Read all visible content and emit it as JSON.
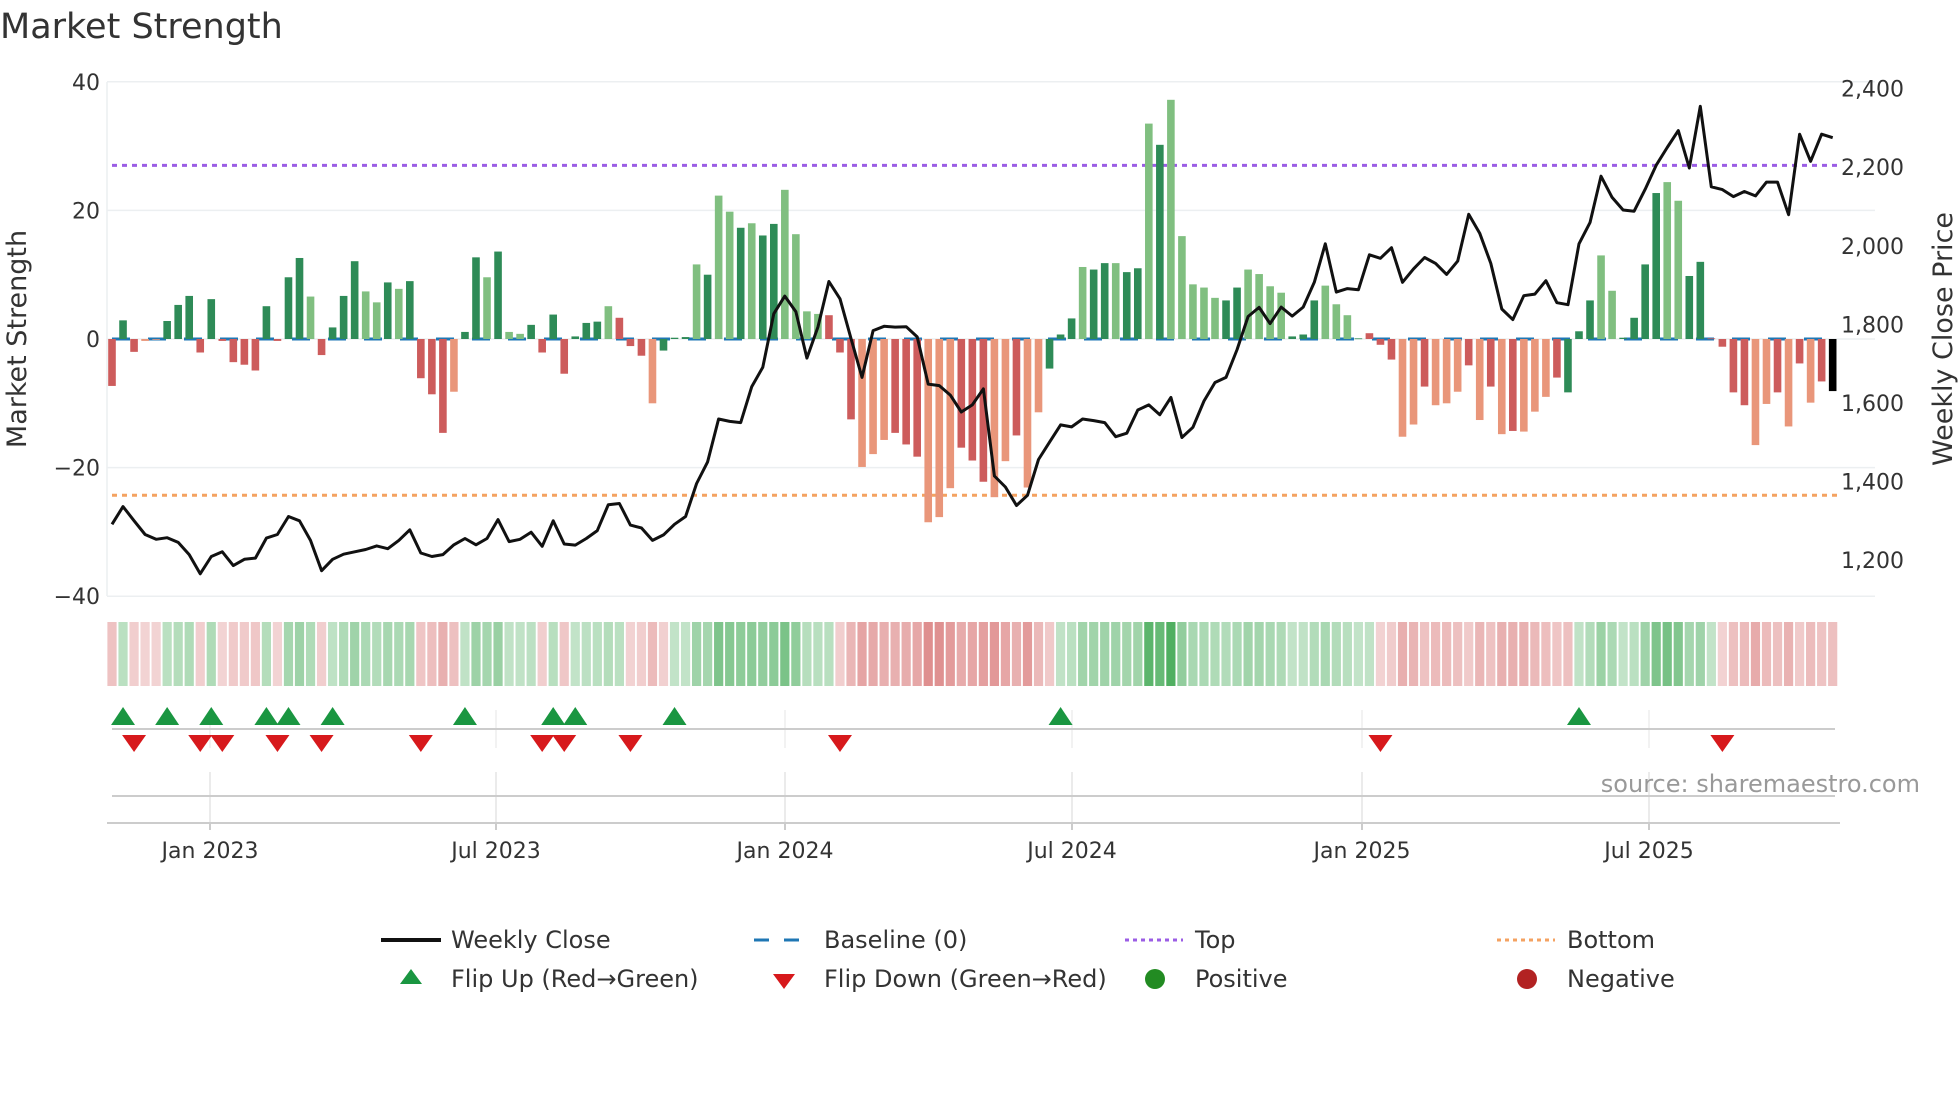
{
  "chart_data": {
    "type": "bar+line",
    "title": "Market Strength",
    "ylabel_left": "Market Strength",
    "ylabel_right": "Weekly Close Price",
    "ylim_left": [
      -40,
      40
    ],
    "ylim_right": [
      1100,
      2400
    ],
    "yticks_left": [
      "40",
      "20",
      "0",
      "−20",
      "−40"
    ],
    "yticks_left_values": [
      40,
      20,
      0,
      -20,
      -40
    ],
    "yticks_right": [
      "2,400",
      "2,200",
      "2,000",
      "1,800",
      "1,600",
      "1,400",
      "1,200"
    ],
    "yticks_right_values": [
      2400,
      2200,
      2000,
      1800,
      1600,
      1400,
      1200
    ],
    "xticks": [
      "Jan 2023",
      "Jul 2023",
      "Jan 2024",
      "Jul 2024",
      "Jan 2025",
      "Jul 2025"
    ],
    "top_threshold": 27,
    "bottom_threshold": -24.3,
    "baseline": 0,
    "strength": [
      -7.3,
      2.9,
      -2,
      -0.3,
      -0.1,
      2.8,
      5.3,
      6.7,
      -2.1,
      6.2,
      -0.3,
      -3.6,
      -4,
      -4.9,
      5.1,
      -0.3,
      9.6,
      12.6,
      6.6,
      -2.5,
      1.8,
      6.7,
      12.1,
      7.4,
      5.7,
      8.8,
      7.8,
      9,
      -6.1,
      -8.6,
      -14.6,
      -8.2,
      1.1,
      12.7,
      9.6,
      13.6,
      1.1,
      0.8,
      2.2,
      -2.1,
      3.8,
      -5.4,
      0.4,
      2.5,
      2.7,
      5.1,
      3.3,
      -1.1,
      -2.6,
      -10,
      -1.8,
      0.2,
      0.3,
      11.6,
      10,
      22.3,
      19.8,
      17.3,
      18,
      16.1,
      17.9,
      23.2,
      16.3,
      4.3,
      3.9,
      3.7,
      -2.1,
      -12.5,
      -19.9,
      -17.9,
      -15.7,
      -14.6,
      -16.4,
      -18.3,
      -28.5,
      -27.7,
      -23.2,
      -16.9,
      -18.9,
      -22.2,
      -24.6,
      -19,
      -15,
      -23.1,
      -11.4,
      -4.6,
      0.7,
      3.2,
      11.2,
      10.8,
      11.8,
      11.8,
      10.4,
      11,
      33.5,
      30.2,
      37.2,
      16,
      8.5,
      8,
      6.4,
      6,
      8,
      10.8,
      10.1,
      8.2,
      7.2,
      0.4,
      0.7,
      6,
      8.3,
      5.4,
      3.7,
      0.1,
      0.9,
      -0.9,
      -3.2,
      -15.2,
      -13.3,
      -7.4,
      -10.3,
      -10,
      -8.2,
      -4.1,
      -12.6,
      -7.4,
      -14.8,
      -14.3,
      -14.4,
      -11.3,
      -9,
      -6,
      -8.3,
      1.2,
      6,
      13,
      7.5,
      0.2,
      3.3,
      11.6,
      22.7,
      24.4,
      21.5,
      9.8,
      12,
      0.1,
      -1.2,
      -8.3,
      -10.3,
      -16.5,
      -10.1,
      -8.3,
      -13.6,
      -3.8,
      -9.9,
      -6.6,
      -8.1
    ],
    "strength_shade": "RGRrrGGGRGRRRRGRGGgRGGGggGgGRRRrGGgGggGRGRGGGgRRRrGGGgGggGgGGggggRRRrrrRRRrrrRRRrrRrrGGGgGGgGGgGgggggGGggggGGGgggGRRRrrRrrrRrRrRrrrRGGGggGGGGggGGRRRRrrRrRrR",
    "weekly_close": [
      1291,
      1336,
      1300,
      1265,
      1253,
      1257,
      1245,
      1214,
      1165,
      1209,
      1221,
      1186,
      1202,
      1205,
      1256,
      1265,
      1311,
      1300,
      1250,
      1173,
      1202,
      1215,
      1221,
      1227,
      1236,
      1229,
      1250,
      1277,
      1218,
      1209,
      1214,
      1239,
      1255,
      1239,
      1255,
      1303,
      1247,
      1253,
      1271,
      1235,
      1300,
      1241,
      1238,
      1255,
      1275,
      1341,
      1344,
      1289,
      1282,
      1250,
      1264,
      1291,
      1311,
      1395,
      1450,
      1559,
      1553,
      1550,
      1641,
      1691,
      1827,
      1872,
      1832,
      1714,
      1793,
      1909,
      1865,
      1764,
      1665,
      1784,
      1795,
      1793,
      1794,
      1768,
      1648,
      1644,
      1620,
      1577,
      1595,
      1636,
      1414,
      1386,
      1339,
      1365,
      1456,
      1500,
      1544,
      1539,
      1559,
      1555,
      1550,
      1514,
      1523,
      1582,
      1595,
      1570,
      1614,
      1512,
      1538,
      1605,
      1652,
      1665,
      1736,
      1820,
      1843,
      1802,
      1844,
      1821,
      1844,
      1907,
      2005,
      1882,
      1891,
      1888,
      1977,
      1968,
      1995,
      1907,
      1941,
      1970,
      1955,
      1927,
      1961,
      2080,
      2032,
      1955,
      1839,
      1812,
      1873,
      1877,
      1911,
      1855,
      1850,
      2005,
      2059,
      2177,
      2123,
      2091,
      2088,
      2144,
      2205,
      2250,
      2293,
      2198,
      2355,
      2150,
      2143,
      2125,
      2138,
      2127,
      2162,
      2162,
      2079,
      2284,
      2215,
      2284,
      2275
    ],
    "colors": {
      "strong_green": "#2e8b57",
      "light_green": "#80bf80",
      "strong_red": "#cd5c5c",
      "light_red": "#e9967a",
      "line": "#111111",
      "baseline": "#1f77b4",
      "top": "#9b5de5",
      "bottom": "#f4a261",
      "flip_up": "#1a9641",
      "flip_down": "#d7191c",
      "positive": "#228b22",
      "negative": "#b22222"
    },
    "legend": {
      "placement": "bottom",
      "items": [
        {
          "label": "Weekly Close",
          "kind": "line"
        },
        {
          "label": "Baseline (0)",
          "kind": "dash"
        },
        {
          "label": "Top",
          "kind": "dot-top"
        },
        {
          "label": "Bottom",
          "kind": "dot-bottom"
        },
        {
          "label": "Flip Up (Red→Green)",
          "kind": "tri-up"
        },
        {
          "label": "Flip Down (Green→Red)",
          "kind": "tri-down"
        },
        {
          "label": "Positive",
          "kind": "dot-pos"
        },
        {
          "label": "Negative",
          "kind": "dot-neg"
        }
      ]
    },
    "source": "source: sharemaestro.com"
  }
}
